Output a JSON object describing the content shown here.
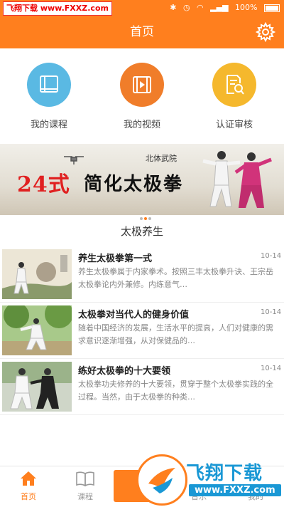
{
  "status_bar": {
    "watermark": "飞翔下载 www.FXXZ.com",
    "battery": "100%"
  },
  "header": {
    "title": "首页"
  },
  "quick_actions": [
    {
      "label": "我的课程",
      "color": "#5ab9e3"
    },
    {
      "label": "我的视频",
      "color": "#f07d2a"
    },
    {
      "label": "认证审核",
      "color": "#f5b82d"
    }
  ],
  "banner": {
    "source": "北体武院",
    "number": "24式",
    "title": "简化太极拳"
  },
  "section": {
    "title": "太极养生"
  },
  "news": [
    {
      "title": "养生太极拳第一式",
      "date": "10-14",
      "summary": "养生太极拳属于内家拳术。按照三丰太极拳升诀、王宗岳太极拳论内外兼修。内练意气…"
    },
    {
      "title": "太极拳对当代人的健身价值",
      "date": "10-14",
      "summary": "随着中国经济的发展，生活水平的提高，人们对健康的需求意识逐渐增强，从对保健品的…"
    },
    {
      "title": "练好太极拳的十大要领",
      "date": "10-14",
      "summary": "太极拳功夫修养的十大要领，贯穿于整个太极拳实践的全过程。当然，由于太极拳的种类…"
    }
  ],
  "tabs": [
    {
      "label": "首页"
    },
    {
      "label": "课程"
    },
    {
      "label": ""
    },
    {
      "label": "音乐"
    },
    {
      "label": "我的"
    }
  ],
  "watermark_logo": {
    "brand": "飞翔下载",
    "url": "www.FXXZ.com"
  },
  "colors": {
    "accent": "#ff7f1e",
    "brand_blue": "#1a98d5"
  }
}
